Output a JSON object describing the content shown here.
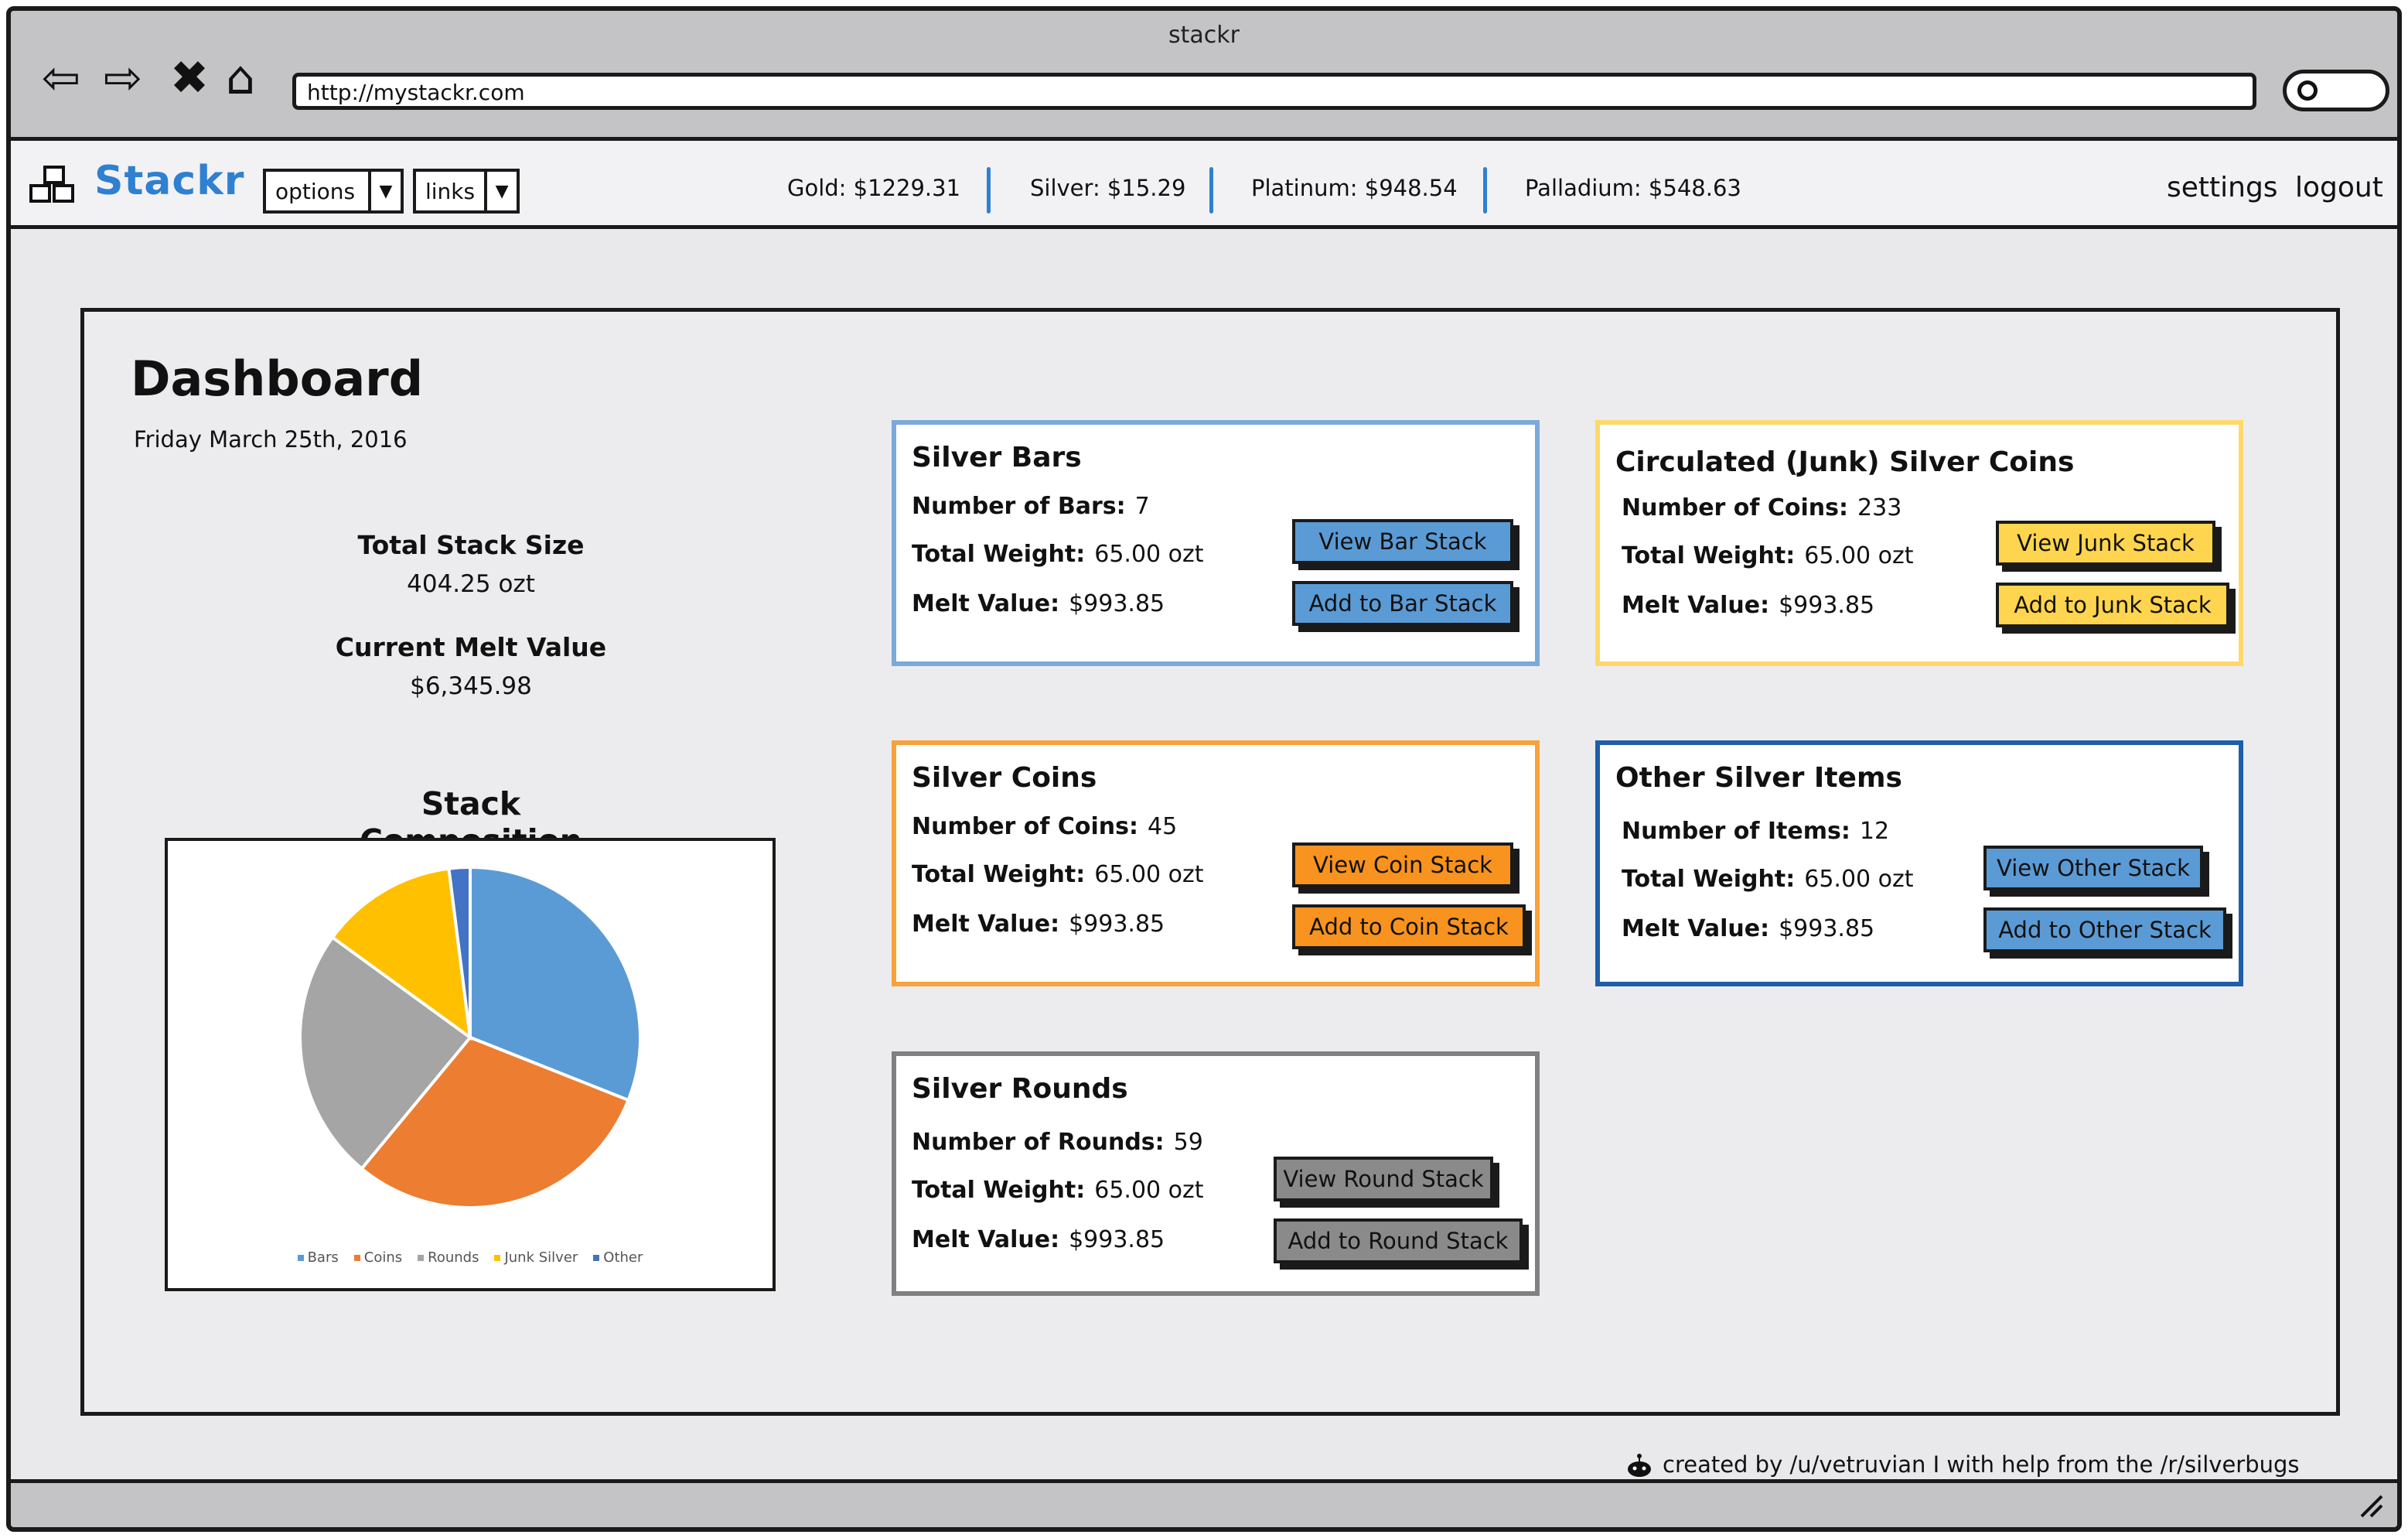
{
  "window": {
    "title": "stackr",
    "url": "http://mystackr.com"
  },
  "appbar": {
    "brand": "Stackr",
    "options_label": "options",
    "links_label": "links",
    "prices": [
      {
        "label": "Gold: $1229.31"
      },
      {
        "label": "Silver: $15.29"
      },
      {
        "label": "Platinum: $948.54"
      },
      {
        "label": "Palladium: $548.63"
      }
    ],
    "settings_label": "settings",
    "logout_label": "logout"
  },
  "dashboard": {
    "title": "Dashboard",
    "date": "Friday March 25th, 2016",
    "total_stack_label": "Total Stack Size",
    "total_stack_value": "404.25 ozt",
    "melt_value_label": "Current Melt Value",
    "melt_value_value": "$6,345.98",
    "composition_title": "Stack Composition"
  },
  "chart_data": {
    "type": "pie",
    "title": "Stack Composition",
    "categories": [
      "Bars",
      "Coins",
      "Rounds",
      "Junk Silver",
      "Other"
    ],
    "values": [
      31,
      30,
      24,
      13,
      2
    ],
    "colors": [
      "#5b9bd5",
      "#ed7d31",
      "#a5a5a5",
      "#ffc000",
      "#4472c4"
    ],
    "legend_position": "bottom"
  },
  "cards": {
    "bars": {
      "title": "Silver Bars",
      "count_label": "Number of Bars:",
      "count_value": "7",
      "weight_label": "Total Weight:",
      "weight_value": "65.00 ozt",
      "melt_label": "Melt Value:",
      "melt_value": "$993.85",
      "view_btn": "View Bar Stack",
      "add_btn": "Add to Bar Stack",
      "accent": "#7aa9da"
    },
    "junk": {
      "title": "Circulated (Junk) Silver Coins",
      "count_label": "Number of Coins:",
      "count_value": "233",
      "weight_label": "Total Weight:",
      "weight_value": "65.00 ozt",
      "melt_label": "Melt Value:",
      "melt_value": "$993.85",
      "view_btn": "View Junk Stack",
      "add_btn": "Add to Junk Stack",
      "accent": "#ffd86a"
    },
    "coins": {
      "title": "Silver Coins",
      "count_label": "Number of Coins:",
      "count_value": "45",
      "weight_label": "Total Weight:",
      "weight_value": "65.00 ozt",
      "melt_label": "Melt Value:",
      "melt_value": "$993.85",
      "view_btn": "View Coin Stack",
      "add_btn": "Add to Coin Stack",
      "accent": "#f7a23b"
    },
    "other": {
      "title": "Other Silver Items",
      "count_label": "Number of Items:",
      "count_value": "12",
      "weight_label": "Total Weight:",
      "weight_value": "65.00 ozt",
      "melt_label": "Melt Value:",
      "melt_value": "$993.85",
      "view_btn": "View Other Stack",
      "add_btn": "Add to Other Stack",
      "accent": "#1f5ea8"
    },
    "rounds": {
      "title": "Silver Rounds",
      "count_label": "Number of Rounds:",
      "count_value": "59",
      "weight_label": "Total Weight:",
      "weight_value": "65.00 ozt",
      "melt_label": "Melt Value:",
      "melt_value": "$993.85",
      "view_btn": "View Round Stack",
      "add_btn": "Add to Round Stack",
      "accent": "#808080"
    }
  },
  "footer": {
    "credit": "created by /u/vetruvian I with help from the /r/silverbugs community"
  }
}
